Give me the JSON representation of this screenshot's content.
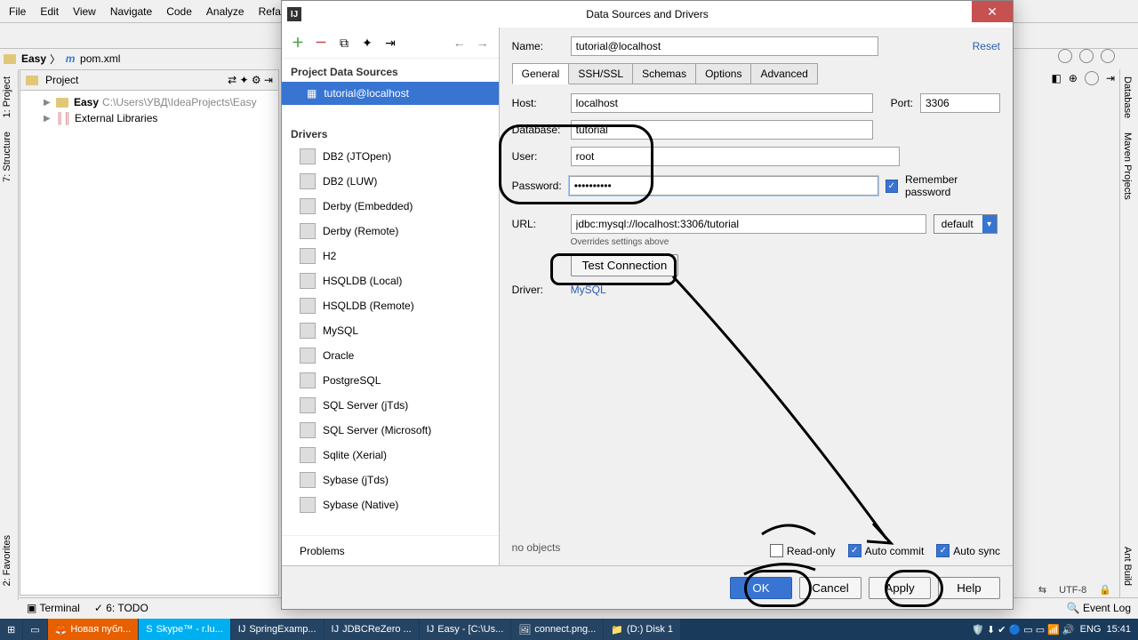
{
  "ide": {
    "menu": [
      "File",
      "Edit",
      "View",
      "Navigate",
      "Code",
      "Analyze",
      "Refactor"
    ],
    "breadcrumb": {
      "project": "Easy",
      "file": "pom.xml"
    },
    "project_panel": {
      "title": "Project",
      "root": "Easy",
      "root_path": "C:\\Users\\УВД\\IdeaProjects\\Easy",
      "ext_lib": "External Libraries"
    },
    "left_tabs": {
      "project": "1: Project",
      "structure": "7: Structure",
      "favorites": "2: Favorites"
    },
    "right_tabs": {
      "database": "Database",
      "maven": "Maven Projects",
      "ant": "Ant Build"
    },
    "bottom": {
      "terminal": "Terminal",
      "todo": "6: TODO",
      "event_log": "Event Log"
    },
    "status": {
      "encoding": "UTF-8"
    }
  },
  "dialog": {
    "title": "Data Sources and Drivers",
    "left": {
      "section1": "Project Data Sources",
      "ds": "tutorial@localhost",
      "section2": "Drivers",
      "drivers": [
        "DB2 (JTOpen)",
        "DB2 (LUW)",
        "Derby (Embedded)",
        "Derby (Remote)",
        "H2",
        "HSQLDB (Local)",
        "HSQLDB (Remote)",
        "MySQL",
        "Oracle",
        "PostgreSQL",
        "SQL Server (jTds)",
        "SQL Server (Microsoft)",
        "Sqlite (Xerial)",
        "Sybase (jTds)",
        "Sybase (Native)"
      ],
      "problems": "Problems"
    },
    "name_label": "Name:",
    "name": "tutorial@localhost",
    "reset": "Reset",
    "tabs": [
      "General",
      "SSH/SSL",
      "Schemas",
      "Options",
      "Advanced"
    ],
    "host_label": "Host:",
    "host": "localhost",
    "port_label": "Port:",
    "port": "3306",
    "db_label": "Database:",
    "db": "tutorial",
    "user_label": "User:",
    "user": "root",
    "pw_label": "Password:",
    "pw": "••••••••••",
    "remember": "Remember password",
    "url_label": "URL:",
    "url": "jdbc:mysql://localhost:3306/tutorial",
    "url_dd": "default",
    "url_hint": "Overrides settings above",
    "test": "Test Connection",
    "driver_label": "Driver:",
    "driver": "MySQL",
    "no_objects": "no objects",
    "readonly": "Read-only",
    "autocommit": "Auto commit",
    "autosync": "Auto sync",
    "buttons": {
      "ok": "OK",
      "cancel": "Cancel",
      "apply": "Apply",
      "help": "Help"
    }
  },
  "taskbar": {
    "items": [
      "Новая публ...",
      "Skype™ - r.lu...",
      "SpringExamp...",
      "JDBCReZero ...",
      "Easy - [C:\\Us...",
      "connect.png...",
      "(D:) Disk 1"
    ],
    "lang": "ENG",
    "time": "15:41"
  }
}
